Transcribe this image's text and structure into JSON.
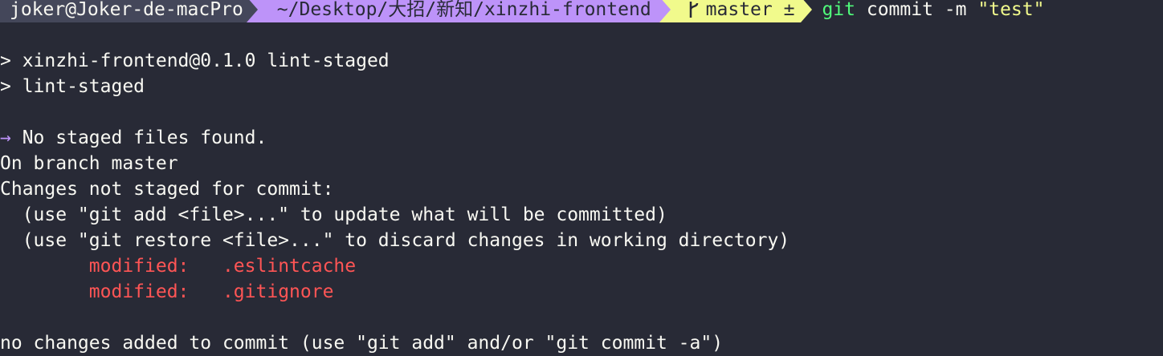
{
  "prompt": {
    "user_host": "joker@Joker-de-macPro",
    "path": "~/Desktop/大招/新知/xinzhi-frontend",
    "branch": "master ±",
    "branch_icon": "git-branch-icon",
    "command_git": "git",
    "command_rest": " commit -m ",
    "command_arg": "\"test\""
  },
  "output": {
    "line1": "> xinzhi-frontend@0.1.0 lint-staged",
    "line2": "> lint-staged",
    "arrow": "→",
    "line3": " No staged files found.",
    "line4": "On branch master",
    "line5": "Changes not staged for commit:",
    "line6": "  (use \"git add <file>...\" to update what will be committed)",
    "line7": "  (use \"git restore <file>...\" to discard changes in working directory)",
    "modified_files": [
      {
        "status": "modified:",
        "file": ".eslintcache"
      },
      {
        "status": "modified:",
        "file": ".gitignore"
      }
    ],
    "line10": "no changes added to commit (use \"git add\" and/or \"git commit -a\")"
  },
  "colors": {
    "background": "#282a36",
    "user_segment": "#44475a",
    "path_segment": "#bd93f9",
    "git_segment": "#f1fa8c",
    "command_git": "#50fa7b",
    "modified": "#ff5555"
  }
}
